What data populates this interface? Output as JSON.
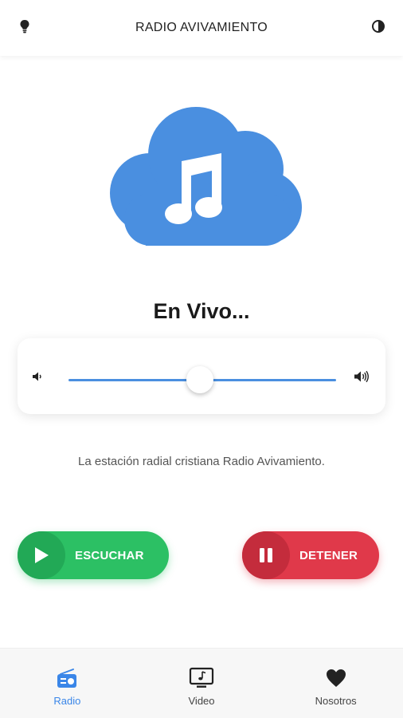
{
  "header": {
    "title": "RADIO AVIVAMIENTO",
    "left_icon": "lightbulb-icon",
    "right_icon": "contrast-icon"
  },
  "hero": {
    "icon": "cloud-music-icon",
    "color": "#4a8fe0"
  },
  "player": {
    "status": "En Vivo...",
    "volume_fraction": 0.49,
    "volume_low_icon": "volume-low-icon",
    "volume_high_icon": "volume-high-icon",
    "track_color": "#4a8fe0"
  },
  "description": "La estación radial cristiana Radio Avivamiento.",
  "buttons": {
    "play_label": "ESCUCHAR",
    "play_color": "#2cc064",
    "stop_label": "DETENER",
    "stop_color": "#e0394a"
  },
  "nav": {
    "items": [
      {
        "label": "Radio",
        "icon": "radio-icon",
        "active": true
      },
      {
        "label": "Video",
        "icon": "tv-icon",
        "active": false
      },
      {
        "label": "Nosotros",
        "icon": "heart-icon",
        "active": false
      }
    ],
    "active_color": "#3a86e8"
  }
}
